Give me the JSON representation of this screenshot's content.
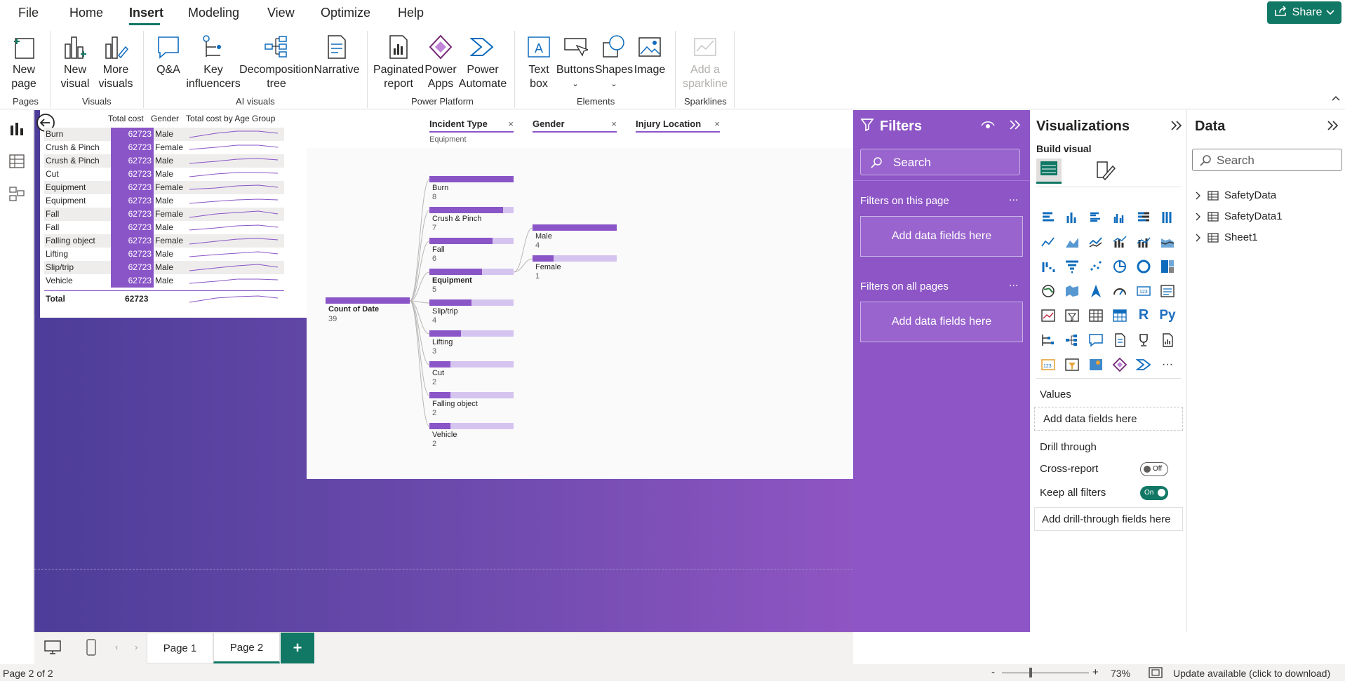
{
  "menu": {
    "items": [
      "File",
      "Home",
      "Insert",
      "Modeling",
      "View",
      "Optimize",
      "Help"
    ],
    "active": "Insert",
    "share_label": "Share"
  },
  "ribbon": {
    "buttons": {
      "new_page": "New\npage",
      "new_visual": "New\nvisual",
      "more_visuals": "More\nvisuals",
      "qa": "Q&A",
      "key_influencers": "Key\ninfluencers",
      "decomposition_tree": "Decomposition\ntree",
      "narrative": "Narrative",
      "paginated_report": "Paginated\nreport",
      "power_apps": "Power\nApps",
      "power_automate": "Power\nAutomate",
      "text_box": "Text\nbox",
      "buttons": "Buttons",
      "shapes": "Shapes",
      "image": "Image",
      "add_sparkline": "Add a\nsparkline"
    },
    "groups": {
      "pages": "Pages",
      "visuals": "Visuals",
      "ai_visuals": "AI visuals",
      "power_platform": "Power Platform",
      "elements": "Elements",
      "sparklines": "Sparklines"
    }
  },
  "table": {
    "headers": {
      "cost": "Total cost",
      "gender": "Gender",
      "spark": "Total cost by Age Group"
    },
    "rows": [
      {
        "cat": "Burn",
        "cost": "62723",
        "gender": "Male"
      },
      {
        "cat": "Crush & Pinch",
        "cost": "62723",
        "gender": "Female"
      },
      {
        "cat": "Crush & Pinch",
        "cost": "62723",
        "gender": "Male"
      },
      {
        "cat": "Cut",
        "cost": "62723",
        "gender": "Male"
      },
      {
        "cat": "Equipment",
        "cost": "62723",
        "gender": "Female"
      },
      {
        "cat": "Equipment",
        "cost": "62723",
        "gender": "Male"
      },
      {
        "cat": "Fall",
        "cost": "62723",
        "gender": "Female"
      },
      {
        "cat": "Fall",
        "cost": "62723",
        "gender": "Male"
      },
      {
        "cat": "Falling object",
        "cost": "62723",
        "gender": "Female"
      },
      {
        "cat": "Lifting",
        "cost": "62723",
        "gender": "Male"
      },
      {
        "cat": "Slip/trip",
        "cost": "62723",
        "gender": "Male"
      },
      {
        "cat": "Vehicle",
        "cost": "62723",
        "gender": "Male"
      }
    ],
    "total_label": "Total",
    "total_value": "62723"
  },
  "decomp": {
    "fields": [
      {
        "name": "Incident Type",
        "sub": "Equipment"
      },
      {
        "name": "Gender",
        "sub": ""
      },
      {
        "name": "Injury Location",
        "sub": ""
      }
    ],
    "root": {
      "label": "Count of Date",
      "value": "39"
    },
    "level1": [
      {
        "label": "Burn",
        "value": 8,
        "fill": 1.0
      },
      {
        "label": "Crush & Pinch",
        "value": 7,
        "fill": 0.875
      },
      {
        "label": "Fall",
        "value": 6,
        "fill": 0.75
      },
      {
        "label": "Equipment",
        "value": 5,
        "fill": 0.625,
        "selected": true
      },
      {
        "label": "Slip/trip",
        "value": 4,
        "fill": 0.5
      },
      {
        "label": "Lifting",
        "value": 3,
        "fill": 0.375
      },
      {
        "label": "Cut",
        "value": 2,
        "fill": 0.25
      },
      {
        "label": "Falling object",
        "value": 2,
        "fill": 0.25
      },
      {
        "label": "Vehicle",
        "value": 2,
        "fill": 0.25
      }
    ],
    "level2": [
      {
        "label": "Male",
        "value": 4,
        "fill": 1.0
      },
      {
        "label": "Female",
        "value": 1,
        "fill": 0.25
      }
    ]
  },
  "filters": {
    "title": "Filters",
    "search_placeholder": "Search",
    "this_page": "Filters on this page",
    "all_pages": "Filters on all pages",
    "add_label": "Add data fields here",
    "more": "..."
  },
  "viz": {
    "title": "Visualizations",
    "build": "Build visual",
    "values_label": "Values",
    "values_add": "Add data fields here",
    "drill_label": "Drill through",
    "cross_report": "Cross-report",
    "cross_state": "Off",
    "keep_filters": "Keep all filters",
    "keep_state": "On",
    "drill_add": "Add drill-through fields here",
    "icons": [
      "stacked-bar-icon",
      "stacked-column-icon",
      "clustered-bar-icon",
      "clustered-column-icon",
      "100-bar-icon",
      "100-column-icon",
      "line-chart-icon",
      "area-chart-icon",
      "stacked-area-icon",
      "line-column-icon",
      "line-clustered-icon",
      "ribbon-chart-icon",
      "waterfall-icon",
      "funnel-icon",
      "scatter-icon",
      "pie-chart-icon",
      "donut-chart-icon",
      "treemap-icon",
      "map-icon",
      "filled-map-icon",
      "azure-map-icon",
      "gauge-icon",
      "card-icon",
      "multirow-card-icon",
      "kpi-icon",
      "slicer-icon",
      "table-icon",
      "matrix-icon",
      "r-visual-icon",
      "python-visual-icon",
      "key-influencers-icon",
      "decomposition-tree-icon",
      "qa-icon",
      "narrative-icon",
      "trophy-icon",
      "paginated-icon",
      "card-new-icon",
      "slicer-new-icon",
      "arcgis-icon",
      "power-apps-icon",
      "power-automate-icon",
      "more-icon"
    ],
    "r_text": "R",
    "py_text": "Py",
    "more_text": "···"
  },
  "data": {
    "title": "Data",
    "search_placeholder": "Search",
    "tables": [
      "SafetyData",
      "SafetyData1",
      "Sheet1"
    ]
  },
  "pages": {
    "tabs": [
      "Page 1",
      "Page 2"
    ],
    "active": "Page 2",
    "add": "+"
  },
  "status": {
    "page": "Page 2 of 2",
    "zoom": "73%",
    "update": "Update available (click to download)",
    "minus": "-",
    "plus": "+"
  }
}
